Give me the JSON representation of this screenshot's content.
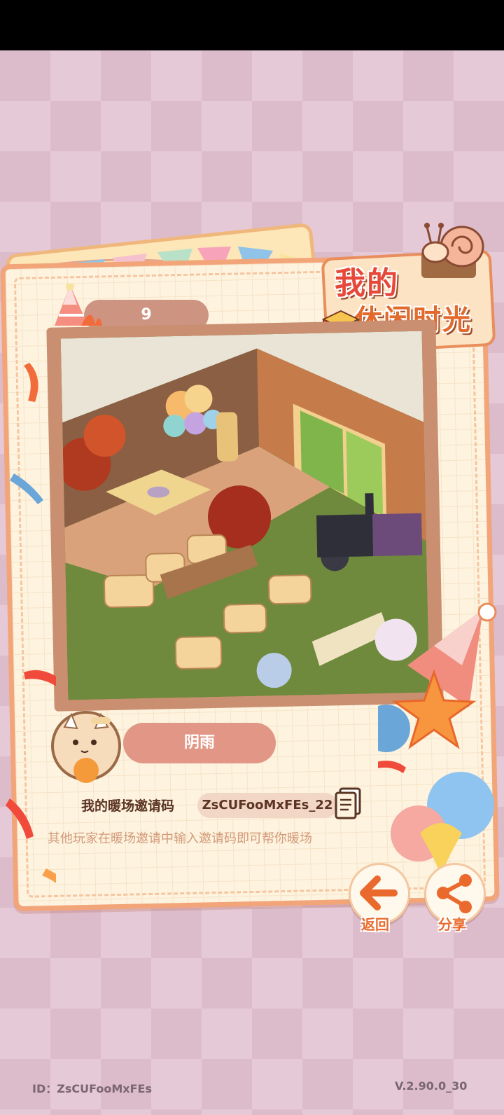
{
  "title": {
    "line1": "我的",
    "line2": "休闲时光"
  },
  "level": "9",
  "weather": "阴雨",
  "invite": {
    "label": "我的暖场邀请码",
    "code": "ZsCUFooMxFEs_22",
    "hint": "其他玩家在暖场邀请中输入邀请码即可帮你暖场"
  },
  "buttons": {
    "back": "返回",
    "share": "分享"
  },
  "footer": {
    "id": "ID：ZsCUFooMxFEs",
    "version": "V.2.90.0_30"
  },
  "colors": {
    "card_border": "#f3a57a",
    "accent": "#e96a2c",
    "title_red": "#e8483a",
    "weather_pill": "#e29786"
  },
  "icons": [
    "party-hat-icon",
    "snail-icon",
    "copy-icon",
    "back-arrow-icon",
    "share-icon",
    "balloon-icon",
    "star-icon"
  ]
}
